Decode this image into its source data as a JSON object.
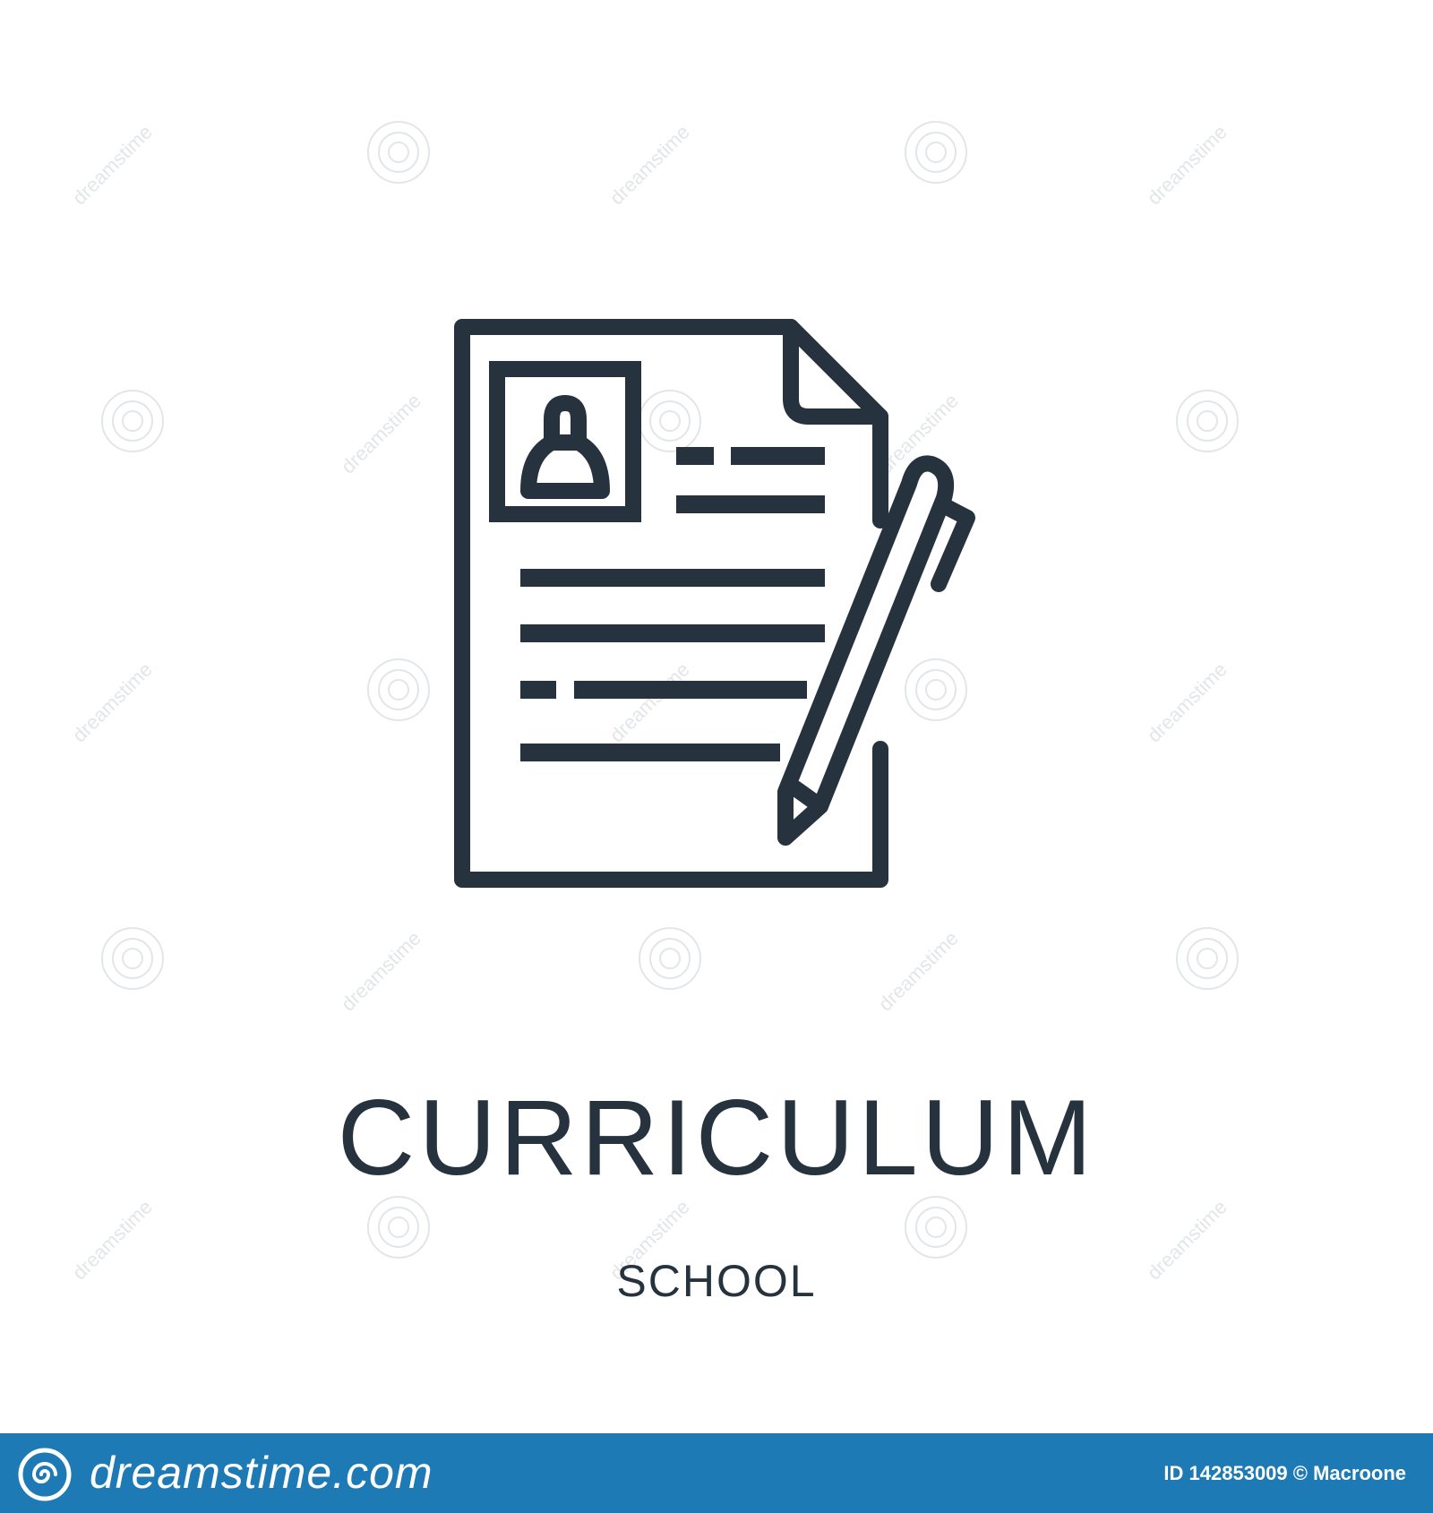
{
  "title": "CURRICULUM",
  "subtitle": "SCHOOL",
  "footer": {
    "brand": "dreamstime.com",
    "credit": "ID 142853009 © Macroone"
  },
  "watermark": {
    "text": "dreamstime"
  },
  "colors": {
    "icon_stroke": "#26333f",
    "text": "#26333f",
    "footer_bg": "#1d7ab5",
    "footer_text": "#ffffff",
    "background": "#ffffff"
  },
  "icons": {
    "main": "curriculum-document-with-pen-icon",
    "footer_logo": "dreamstime-spiral-logo"
  }
}
